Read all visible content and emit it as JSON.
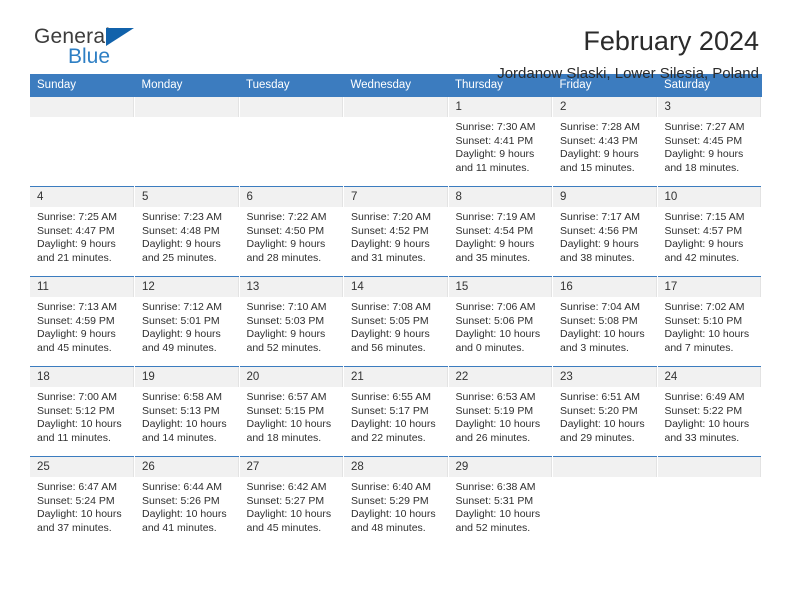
{
  "brand": {
    "name_part1": "General",
    "name_part2": "Blue",
    "triangle_color": "#1162ab",
    "blue_color": "#2e7fc4"
  },
  "header": {
    "title": "February 2024",
    "location": "Jordanow Slaski, Lower Silesia, Poland"
  },
  "calendar": {
    "header_color": "#3c7cbf",
    "daynum_background": "#f1f1f1",
    "weekday_headers": [
      "Sunday",
      "Monday",
      "Tuesday",
      "Wednesday",
      "Thursday",
      "Friday",
      "Saturday"
    ],
    "weeks": [
      [
        {
          "day": "",
          "blank": true,
          "sunrise": "",
          "sunset": "",
          "daylight1": "",
          "daylight2": ""
        },
        {
          "day": "",
          "blank": true,
          "sunrise": "",
          "sunset": "",
          "daylight1": "",
          "daylight2": ""
        },
        {
          "day": "",
          "blank": true,
          "sunrise": "",
          "sunset": "",
          "daylight1": "",
          "daylight2": ""
        },
        {
          "day": "",
          "blank": true,
          "sunrise": "",
          "sunset": "",
          "daylight1": "",
          "daylight2": ""
        },
        {
          "day": "1",
          "blank": false,
          "sunrise": "Sunrise: 7:30 AM",
          "sunset": "Sunset: 4:41 PM",
          "daylight1": "Daylight: 9 hours",
          "daylight2": "and 11 minutes."
        },
        {
          "day": "2",
          "blank": false,
          "sunrise": "Sunrise: 7:28 AM",
          "sunset": "Sunset: 4:43 PM",
          "daylight1": "Daylight: 9 hours",
          "daylight2": "and 15 minutes."
        },
        {
          "day": "3",
          "blank": false,
          "sunrise": "Sunrise: 7:27 AM",
          "sunset": "Sunset: 4:45 PM",
          "daylight1": "Daylight: 9 hours",
          "daylight2": "and 18 minutes."
        }
      ],
      [
        {
          "day": "4",
          "blank": false,
          "sunrise": "Sunrise: 7:25 AM",
          "sunset": "Sunset: 4:47 PM",
          "daylight1": "Daylight: 9 hours",
          "daylight2": "and 21 minutes."
        },
        {
          "day": "5",
          "blank": false,
          "sunrise": "Sunrise: 7:23 AM",
          "sunset": "Sunset: 4:48 PM",
          "daylight1": "Daylight: 9 hours",
          "daylight2": "and 25 minutes."
        },
        {
          "day": "6",
          "blank": false,
          "sunrise": "Sunrise: 7:22 AM",
          "sunset": "Sunset: 4:50 PM",
          "daylight1": "Daylight: 9 hours",
          "daylight2": "and 28 minutes."
        },
        {
          "day": "7",
          "blank": false,
          "sunrise": "Sunrise: 7:20 AM",
          "sunset": "Sunset: 4:52 PM",
          "daylight1": "Daylight: 9 hours",
          "daylight2": "and 31 minutes."
        },
        {
          "day": "8",
          "blank": false,
          "sunrise": "Sunrise: 7:19 AM",
          "sunset": "Sunset: 4:54 PM",
          "daylight1": "Daylight: 9 hours",
          "daylight2": "and 35 minutes."
        },
        {
          "day": "9",
          "blank": false,
          "sunrise": "Sunrise: 7:17 AM",
          "sunset": "Sunset: 4:56 PM",
          "daylight1": "Daylight: 9 hours",
          "daylight2": "and 38 minutes."
        },
        {
          "day": "10",
          "blank": false,
          "sunrise": "Sunrise: 7:15 AM",
          "sunset": "Sunset: 4:57 PM",
          "daylight1": "Daylight: 9 hours",
          "daylight2": "and 42 minutes."
        }
      ],
      [
        {
          "day": "11",
          "blank": false,
          "sunrise": "Sunrise: 7:13 AM",
          "sunset": "Sunset: 4:59 PM",
          "daylight1": "Daylight: 9 hours",
          "daylight2": "and 45 minutes."
        },
        {
          "day": "12",
          "blank": false,
          "sunrise": "Sunrise: 7:12 AM",
          "sunset": "Sunset: 5:01 PM",
          "daylight1": "Daylight: 9 hours",
          "daylight2": "and 49 minutes."
        },
        {
          "day": "13",
          "blank": false,
          "sunrise": "Sunrise: 7:10 AM",
          "sunset": "Sunset: 5:03 PM",
          "daylight1": "Daylight: 9 hours",
          "daylight2": "and 52 minutes."
        },
        {
          "day": "14",
          "blank": false,
          "sunrise": "Sunrise: 7:08 AM",
          "sunset": "Sunset: 5:05 PM",
          "daylight1": "Daylight: 9 hours",
          "daylight2": "and 56 minutes."
        },
        {
          "day": "15",
          "blank": false,
          "sunrise": "Sunrise: 7:06 AM",
          "sunset": "Sunset: 5:06 PM",
          "daylight1": "Daylight: 10 hours",
          "daylight2": "and 0 minutes."
        },
        {
          "day": "16",
          "blank": false,
          "sunrise": "Sunrise: 7:04 AM",
          "sunset": "Sunset: 5:08 PM",
          "daylight1": "Daylight: 10 hours",
          "daylight2": "and 3 minutes."
        },
        {
          "day": "17",
          "blank": false,
          "sunrise": "Sunrise: 7:02 AM",
          "sunset": "Sunset: 5:10 PM",
          "daylight1": "Daylight: 10 hours",
          "daylight2": "and 7 minutes."
        }
      ],
      [
        {
          "day": "18",
          "blank": false,
          "sunrise": "Sunrise: 7:00 AM",
          "sunset": "Sunset: 5:12 PM",
          "daylight1": "Daylight: 10 hours",
          "daylight2": "and 11 minutes."
        },
        {
          "day": "19",
          "blank": false,
          "sunrise": "Sunrise: 6:58 AM",
          "sunset": "Sunset: 5:13 PM",
          "daylight1": "Daylight: 10 hours",
          "daylight2": "and 14 minutes."
        },
        {
          "day": "20",
          "blank": false,
          "sunrise": "Sunrise: 6:57 AM",
          "sunset": "Sunset: 5:15 PM",
          "daylight1": "Daylight: 10 hours",
          "daylight2": "and 18 minutes."
        },
        {
          "day": "21",
          "blank": false,
          "sunrise": "Sunrise: 6:55 AM",
          "sunset": "Sunset: 5:17 PM",
          "daylight1": "Daylight: 10 hours",
          "daylight2": "and 22 minutes."
        },
        {
          "day": "22",
          "blank": false,
          "sunrise": "Sunrise: 6:53 AM",
          "sunset": "Sunset: 5:19 PM",
          "daylight1": "Daylight: 10 hours",
          "daylight2": "and 26 minutes."
        },
        {
          "day": "23",
          "blank": false,
          "sunrise": "Sunrise: 6:51 AM",
          "sunset": "Sunset: 5:20 PM",
          "daylight1": "Daylight: 10 hours",
          "daylight2": "and 29 minutes."
        },
        {
          "day": "24",
          "blank": false,
          "sunrise": "Sunrise: 6:49 AM",
          "sunset": "Sunset: 5:22 PM",
          "daylight1": "Daylight: 10 hours",
          "daylight2": "and 33 minutes."
        }
      ],
      [
        {
          "day": "25",
          "blank": false,
          "sunrise": "Sunrise: 6:47 AM",
          "sunset": "Sunset: 5:24 PM",
          "daylight1": "Daylight: 10 hours",
          "daylight2": "and 37 minutes."
        },
        {
          "day": "26",
          "blank": false,
          "sunrise": "Sunrise: 6:44 AM",
          "sunset": "Sunset: 5:26 PM",
          "daylight1": "Daylight: 10 hours",
          "daylight2": "and 41 minutes."
        },
        {
          "day": "27",
          "blank": false,
          "sunrise": "Sunrise: 6:42 AM",
          "sunset": "Sunset: 5:27 PM",
          "daylight1": "Daylight: 10 hours",
          "daylight2": "and 45 minutes."
        },
        {
          "day": "28",
          "blank": false,
          "sunrise": "Sunrise: 6:40 AM",
          "sunset": "Sunset: 5:29 PM",
          "daylight1": "Daylight: 10 hours",
          "daylight2": "and 48 minutes."
        },
        {
          "day": "29",
          "blank": false,
          "sunrise": "Sunrise: 6:38 AM",
          "sunset": "Sunset: 5:31 PM",
          "daylight1": "Daylight: 10 hours",
          "daylight2": "and 52 minutes."
        },
        {
          "day": "",
          "blank": true,
          "sunrise": "",
          "sunset": "",
          "daylight1": "",
          "daylight2": ""
        },
        {
          "day": "",
          "blank": true,
          "sunrise": "",
          "sunset": "",
          "daylight1": "",
          "daylight2": ""
        }
      ]
    ]
  }
}
